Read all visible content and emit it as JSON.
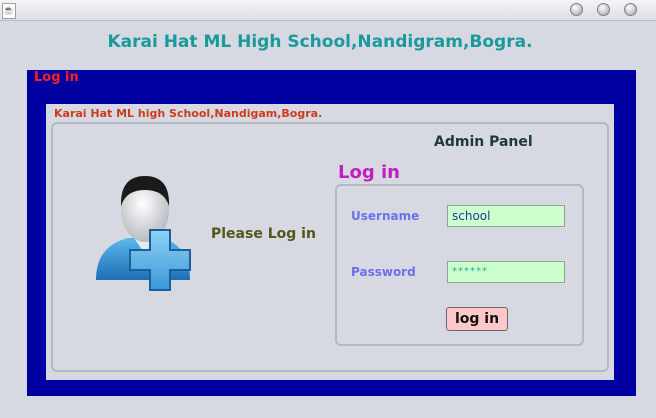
{
  "window": {
    "app_icon": "java-icon"
  },
  "header": {
    "title": "Karai Hat ML High School,Nandigram,Bogra."
  },
  "outer": {
    "label": "Log in"
  },
  "inner": {
    "label": "Karai Hat ML high School,Nandigam,Bogra.",
    "admin_panel": "Admin Panel",
    "login_heading": "Log in",
    "prompt": "Please Log in"
  },
  "form": {
    "username_label": "Username",
    "username_value": "school",
    "password_label": "Password",
    "password_value": "******",
    "login_button": "log in"
  },
  "colors": {
    "frame_blue": "#0000a0",
    "title_teal": "#1a9a9a",
    "input_green": "#ccffcc",
    "button_pink": "#ffc8c8"
  }
}
